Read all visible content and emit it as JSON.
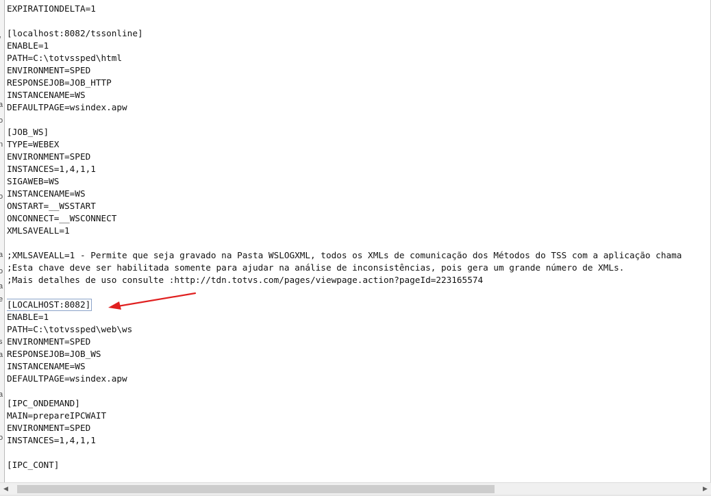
{
  "editor": {
    "lines": [
      "EXPIRATIONDELTA=1",
      "",
      "[localhost:8082/tssonline]",
      "ENABLE=1",
      "PATH=C:\\totvssped\\html",
      "ENVIRONMENT=SPED",
      "RESPONSEJOB=JOB_HTTP",
      "INSTANCENAME=WS",
      "DEFAULTPAGE=wsindex.apw",
      "",
      "[JOB_WS]",
      "TYPE=WEBEX",
      "ENVIRONMENT=SPED",
      "INSTANCES=1,4,1,1",
      "SIGAWEB=WS",
      "INSTANCENAME=WS",
      "ONSTART=__WSSTART",
      "ONCONNECT=__WSCONNECT",
      "XMLSAVEALL=1",
      "",
      ";XMLSAVEALL=1 - Permite que seja gravado na Pasta WSLOGXML, todos os XMLs de comunicação dos Métodos do TSS com a aplicação chama",
      ";Esta chave deve ser habilitada somente para ajudar na análise de inconsistências, pois gera um grande número de XMLs.",
      ";Mais detalhes de uso consulte :http://tdn.totvs.com/pages/viewpage.action?pageId=223165574",
      "",
      "[LOCALHOST:8082]",
      "ENABLE=1",
      "PATH=C:\\totvssped\\web\\ws",
      "ENVIRONMENT=SPED",
      "RESPONSEJOB=JOB_WS",
      "INSTANCENAME=WS",
      "DEFAULTPAGE=wsindex.apw",
      "",
      "[IPC_ONDEMAND]",
      "MAIN=prepareIPCWAIT",
      "ENVIRONMENT=SPED",
      "INSTANCES=1,4,1,1",
      "",
      "[IPC_CONT]"
    ],
    "highlighted_line_index": 24
  },
  "left_strip": {
    "fragments": [
      "/",
      "a",
      "o",
      "n",
      "o",
      "a",
      "o",
      "a",
      "e",
      "s",
      "a",
      "a",
      "o"
    ]
  },
  "annotation": {
    "arrow_color": "#e02020"
  },
  "scrollbar": {
    "left_arrow_icon": "chevron-left-icon",
    "right_arrow_icon": "chevron-right-icon",
    "thumb_fraction": 0.7
  }
}
